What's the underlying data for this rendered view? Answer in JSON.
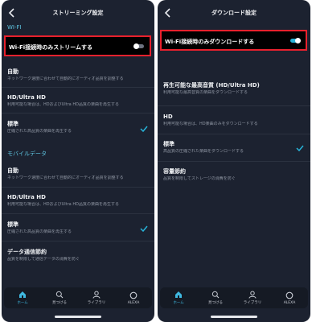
{
  "left": {
    "title": "ストリーミング設定",
    "wifi_section": "WI-FI",
    "wifi_only_label": "Wi-Fi接続時のみストリームする",
    "wifi_options": [
      {
        "title": "自動",
        "desc": "ネットワーク速度に合わせて自動的にオーディオ品質を調整する"
      },
      {
        "title": "HD/Ultra HD",
        "desc": "利用可能な場合は、HDおよびUltra HD品質の楽曲を再生する"
      },
      {
        "title": "標準",
        "desc": "圧縮された高品質の楽曲を再生する"
      }
    ],
    "mobile_section": "モバイルデータ",
    "mobile_options": [
      {
        "title": "自動",
        "desc": "ネットワーク速度に合わせて自動的にオーディオ品質を調整する"
      },
      {
        "title": "HD/Ultra HD",
        "desc": "利用可能な場合は、HDおよびUltra HD品質の楽曲を再生する"
      },
      {
        "title": "標準",
        "desc": "圧縮された高品質の楽曲を再生する"
      },
      {
        "title": "データ通信節約",
        "desc": "品質を制限して通信データの消費を防ぐ"
      }
    ]
  },
  "right": {
    "title": "ダウンロード設定",
    "wifi_only_label": "Wi-Fi接続時のみダウンロードする",
    "options": [
      {
        "title": "再生可能な最高音質 (HD/Ultra HD)",
        "desc": "利用可能な最高音質の楽曲をダウンロードする"
      },
      {
        "title": "HD",
        "desc": "利用可能な場合は、HD楽曲のみをダウンロードする"
      },
      {
        "title": "標準",
        "desc": "高品質の圧縮された楽曲をダウンロードする"
      },
      {
        "title": "容量節約",
        "desc": "品質を制限してストレージの消費を防ぐ"
      }
    ]
  },
  "tabs": [
    {
      "label": "ホーム",
      "icon": "home-icon"
    },
    {
      "label": "見つける",
      "icon": "search-icon"
    },
    {
      "label": "ライブラリ",
      "icon": "person-icon"
    },
    {
      "label": "ALEXA",
      "icon": "alexa-icon"
    }
  ],
  "colors": {
    "accent": "#27b3d8",
    "highlight_border": "#e8212d",
    "panel_bg": "#1c2230"
  }
}
